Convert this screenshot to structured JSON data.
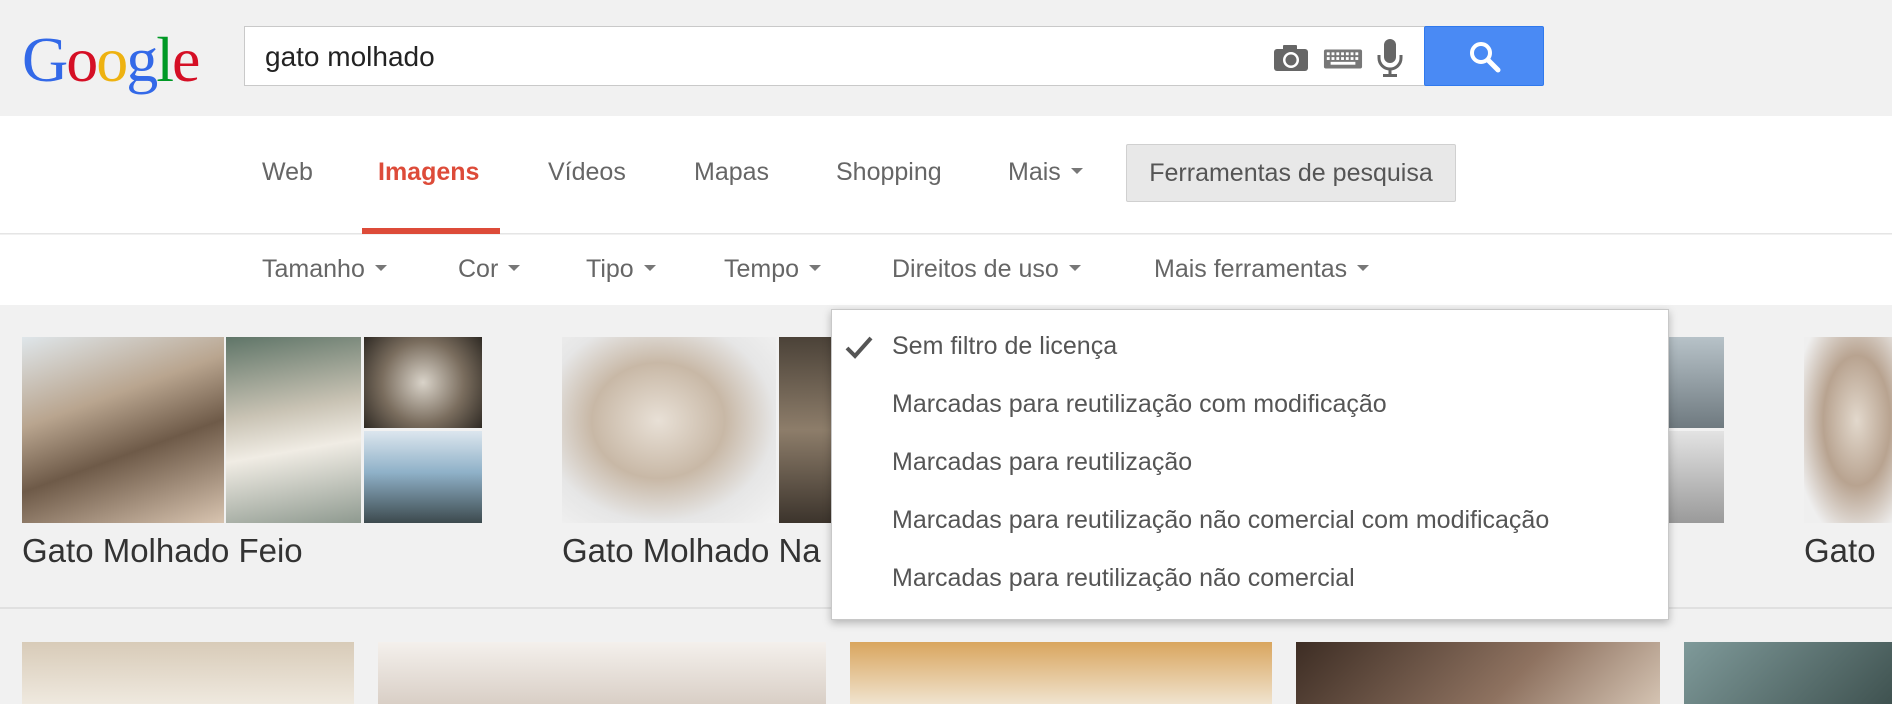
{
  "logo": {
    "letters": [
      "G",
      "o",
      "o",
      "g",
      "l",
      "e"
    ],
    "colors": [
      "#3369e8",
      "#d50f25",
      "#eeb211",
      "#3369e8",
      "#009925",
      "#d50f25"
    ]
  },
  "search": {
    "query": "gato molhado"
  },
  "tabs": [
    {
      "label": "Web",
      "active": false
    },
    {
      "label": "Imagens",
      "active": true
    },
    {
      "label": "Vídeos",
      "active": false
    },
    {
      "label": "Mapas",
      "active": false
    },
    {
      "label": "Shopping",
      "active": false
    },
    {
      "label": "Mais",
      "active": false
    }
  ],
  "tools_button": "Ferramentas de pesquisa",
  "filters": [
    "Tamanho",
    "Cor",
    "Tipo",
    "Tempo",
    "Direitos de uso",
    "Mais ferramentas"
  ],
  "usage_rights_menu": {
    "items": [
      {
        "label": "Sem filtro de licença",
        "checked": true
      },
      {
        "label": "Marcadas para reutilização com modificação",
        "checked": false
      },
      {
        "label": "Marcadas para reutilização",
        "checked": false
      },
      {
        "label": "Marcadas para reutilização não comercial com modificação",
        "checked": false
      },
      {
        "label": "Marcadas para reutilização não comercial",
        "checked": false
      }
    ]
  },
  "result_cards": [
    {
      "title": "Gato Molhado Feio"
    },
    {
      "title": "Gato Molhado Na"
    },
    {
      "title": "Gato"
    }
  ],
  "colors": {
    "accent": "#dd4b39",
    "search_button": "#4a8af4"
  }
}
